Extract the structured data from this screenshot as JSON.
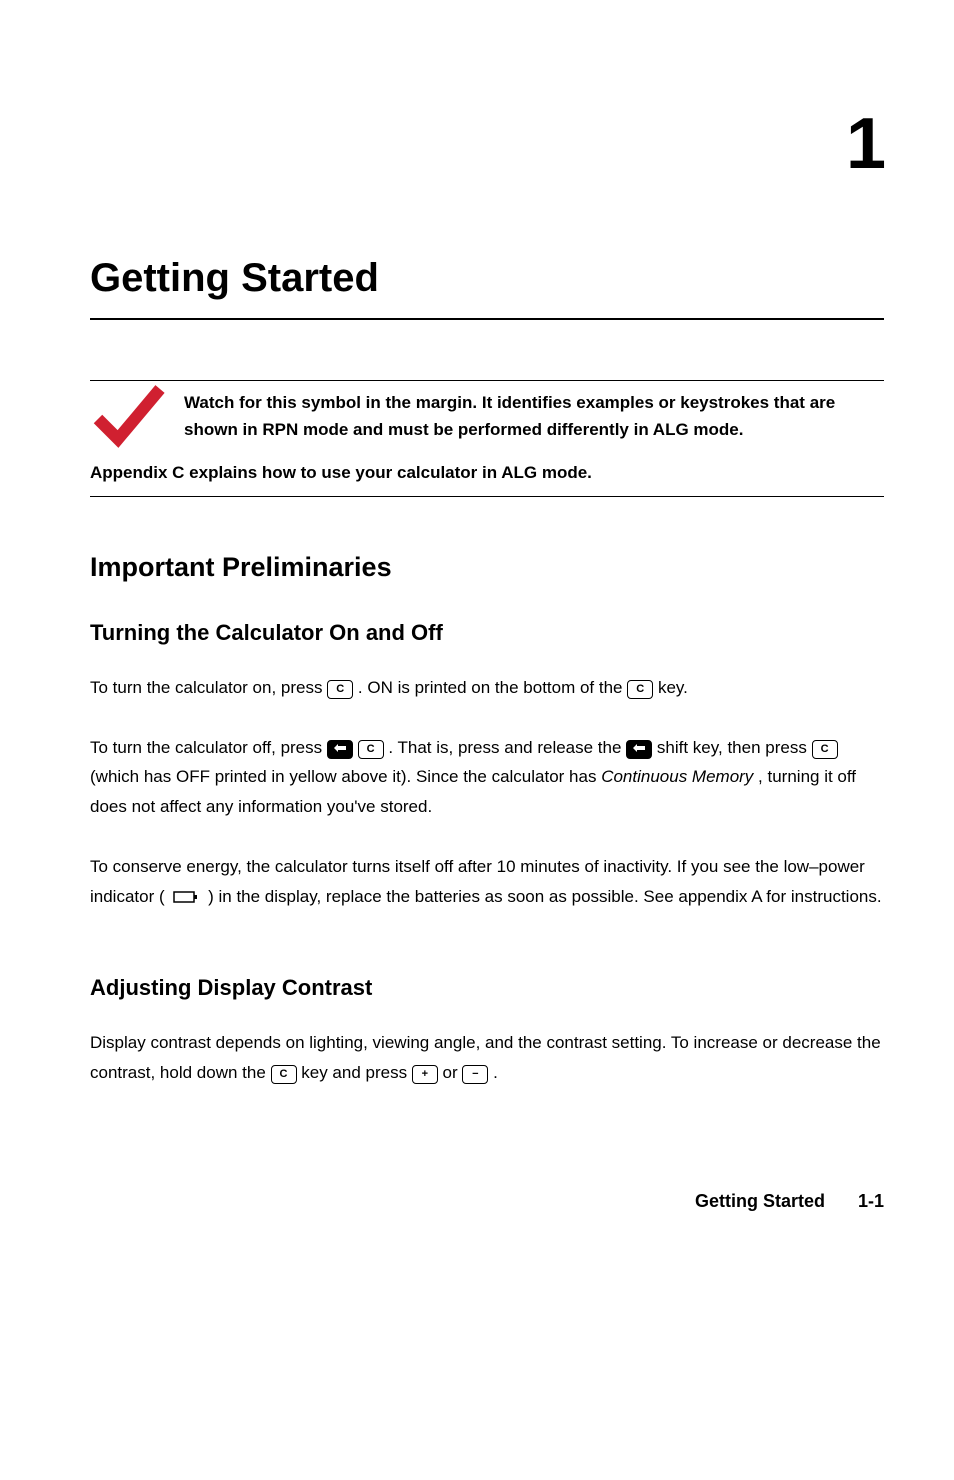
{
  "chapter": {
    "number": "1",
    "title": "Getting Started"
  },
  "callout": {
    "line1": "Watch for this symbol in the margin. It identifies examples or keystrokes that are shown in RPN mode and must be performed differently in ALG mode.",
    "line2": "Appendix C explains how to use your calculator in ALG mode."
  },
  "sections": {
    "important": {
      "heading": "Important Preliminaries",
      "turning": {
        "heading": "Turning the Calculator On and Off",
        "p1_a": "To turn the calculator on, press ",
        "p1_b": ". ON is printed on the bottom of the ",
        "p1_c": " key.",
        "p2_a": "To turn the calculator off, press ",
        "p2_b": ". That is, press and release the ",
        "p2_c": " shift key, then press ",
        "p2_d": " (which has OFF printed in yellow above it). Since the calculator has ",
        "p2_italic": "Continuous Memory",
        "p2_e": ", turning it off does not affect any information you've stored.",
        "p3_a": "To conserve energy, the calculator turns itself off after 10 minutes of inactivity. If you see the low–power indicator ( ",
        "p3_b": " ) in the display, replace the batteries as soon as possible. See appendix A for instructions."
      },
      "contrast": {
        "heading": "Adjusting Display Contrast",
        "p1_a": "Display contrast depends on lighting, viewing angle, and the contrast setting. To increase or decrease the contrast, hold down the ",
        "p1_b": " key and press ",
        "p1_c": " or ",
        "p1_d": "."
      }
    }
  },
  "keys": {
    "c": "C",
    "plus": "+",
    "minus": "−"
  },
  "footer": {
    "title": "Getting Started",
    "page": "1-1"
  }
}
